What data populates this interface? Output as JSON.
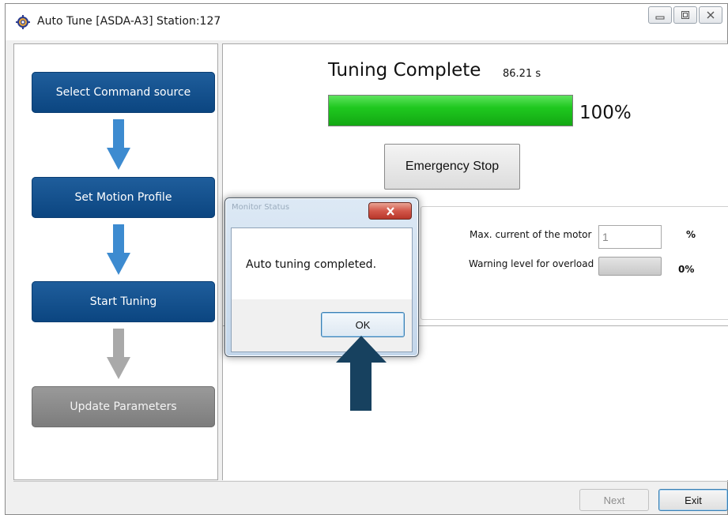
{
  "window": {
    "title": "Auto Tune [ASDA-A3] Station:127",
    "icons": {
      "app": "gear-icon",
      "minimize": "minimize-icon",
      "maximize": "maximize-icon",
      "close": "close-icon"
    }
  },
  "steps": [
    {
      "label": "Select Command source",
      "state": "active"
    },
    {
      "label": "Set Motion Profile",
      "state": "active"
    },
    {
      "label": "Start Tuning",
      "state": "active"
    },
    {
      "label": "Update Parameters",
      "state": "disabled"
    }
  ],
  "tuning": {
    "title": "Tuning Complete",
    "elapsed": "86.21 s",
    "progress_percent": 100,
    "progress_label": "100%",
    "emergency_stop_label": "Emergency Stop"
  },
  "monitor": {
    "max_current_label": "Max. current of the motor",
    "max_current_value": "1",
    "max_current_unit": "%",
    "overload_label": "Warning level for overload",
    "overload_value": "0%"
  },
  "dialog": {
    "title": "Monitor Status",
    "message": "Auto tuning completed.",
    "ok_label": "OK"
  },
  "footer": {
    "next_label": "Next",
    "exit_label": "Exit"
  },
  "colors": {
    "step_active": "#0b4580",
    "step_disabled": "#8a8a8a",
    "flow_arrow_active": "#3d8bd0",
    "flow_arrow_disabled": "#a9a9a9",
    "progress_fill": "#1fc81f",
    "pointer_arrow": "#17415f"
  }
}
